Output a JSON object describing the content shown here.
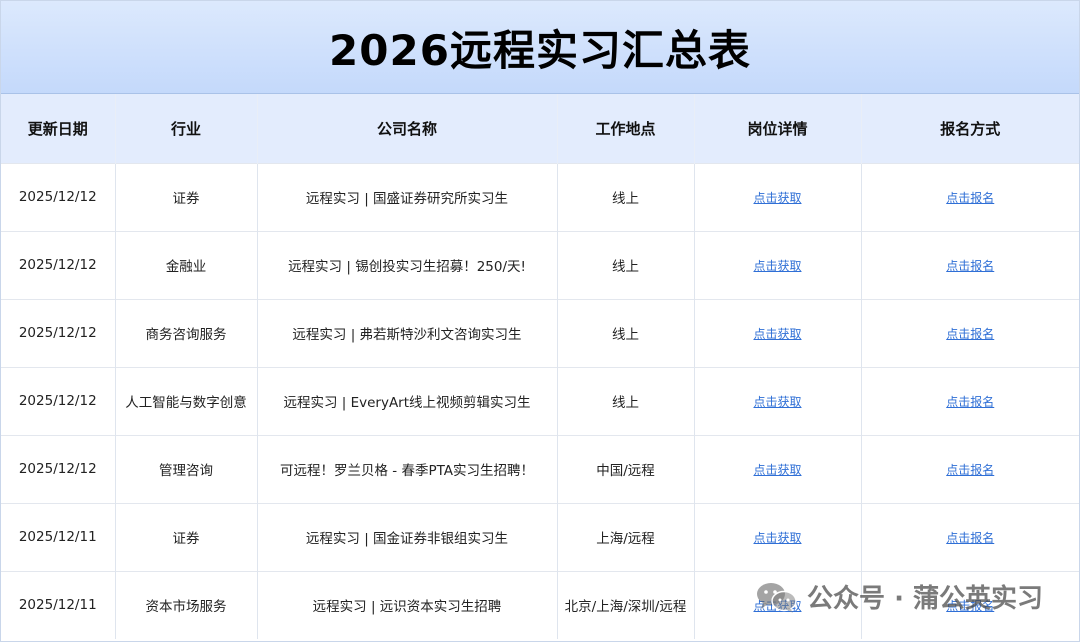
{
  "title": "2026远程实习汇总表",
  "headers": [
    "更新日期",
    "行业",
    "公司名称",
    "工作地点",
    "岗位详情",
    "报名方式"
  ],
  "rows": [
    {
      "date": "2025/12/12",
      "industry": "证券",
      "company": "远程实习 | 国盛证券研究所实习生",
      "location": "线上",
      "detail": "点击获取",
      "apply": "点击报名"
    },
    {
      "date": "2025/12/12",
      "industry": "金融业",
      "company": "远程实习 | 锡创投实习生招募！250/天!",
      "location": "线上",
      "detail": "点击获取",
      "apply": "点击报名"
    },
    {
      "date": "2025/12/12",
      "industry": "商务咨询服务",
      "company": "远程实习 | 弗若斯特沙利文咨询实习生",
      "location": "线上",
      "detail": "点击获取",
      "apply": "点击报名"
    },
    {
      "date": "2025/12/12",
      "industry": "人工智能与数字创意",
      "company": "远程实习 | EveryArt线上视频剪辑实习生",
      "location": "线上",
      "detail": "点击获取",
      "apply": "点击报名"
    },
    {
      "date": "2025/12/12",
      "industry": "管理咨询",
      "company": "可远程！罗兰贝格 - 春季PTA实习生招聘！",
      "location": "中国/远程",
      "detail": "点击获取",
      "apply": "点击报名"
    },
    {
      "date": "2025/12/11",
      "industry": "证券",
      "company": "远程实习 | 国金证券非银组实习生",
      "location": "上海/远程",
      "detail": "点击获取",
      "apply": "点击报名"
    },
    {
      "date": "2025/12/11",
      "industry": "资本市场服务",
      "company": "远程实习 | 远识资本实习生招聘",
      "location": "北京/上海/深圳/远程",
      "detail": "点击获取",
      "apply": "点击报名"
    }
  ],
  "watermark": {
    "text": "公众号 · 蒲公英实习",
    "icon": "wechat-icon"
  },
  "colors": {
    "title_bg": "#c4d9fb",
    "header_bg": "#e3ecfd",
    "link": "#2f6fd6"
  }
}
